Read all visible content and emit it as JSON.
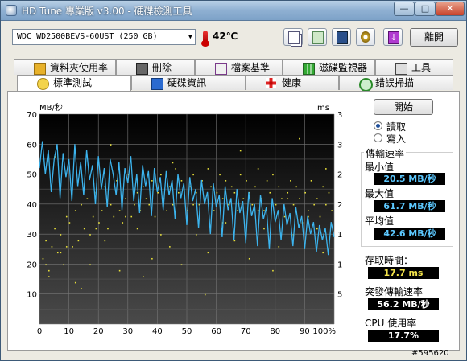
{
  "window": {
    "title": "HD Tune 專業版 v3.00 - 硬碟檢測工具"
  },
  "toolbar": {
    "drive": "WDC WD2500BEVS-60UST (250 GB)",
    "temperature": "42℃",
    "exit_label": "離開"
  },
  "tabs_top": [
    "資料夾使用率",
    "刪除",
    "檔案基準",
    "磁碟監視器",
    "工具"
  ],
  "tabs_bottom": [
    "標準測試",
    "硬碟資訊",
    "健康",
    "錯誤掃描"
  ],
  "controls": {
    "start_label": "開始",
    "read_label": "讀取",
    "write_label": "寫入",
    "mode": "read"
  },
  "stats": {
    "transfer_title": "傳輸速率",
    "min_label": "最小值",
    "min_value": "20.5 MB/秒",
    "max_label": "最大值",
    "max_value": "61.7 MB/秒",
    "avg_label": "平均值",
    "avg_value": "42.6 MB/秒",
    "access_label": "存取時間：",
    "access_value": "17.7 ms",
    "burst_label": "突發傳輸速率",
    "burst_value": "56.2 MB/秒",
    "cpu_label": "CPU 使用率",
    "cpu_value": "17.7%"
  },
  "chart_data": {
    "type": "line",
    "ylabel_left": "MB/秒",
    "ylabel_right": "ms",
    "y_left_ticks": [
      10,
      20,
      30,
      40,
      50,
      60,
      70
    ],
    "y_right_ticks": [
      5,
      10,
      15,
      20,
      25,
      30,
      35
    ],
    "x_ticks": [
      "0",
      "10",
      "20",
      "30",
      "40",
      "50",
      "60",
      "70",
      "80",
      "90",
      "100%"
    ],
    "xlim": [
      0,
      100
    ],
    "ylim_left": [
      0,
      70
    ],
    "ylim_right": [
      0,
      35
    ],
    "series": [
      {
        "x": [
          0,
          1,
          2,
          3,
          4,
          5,
          6,
          7,
          8,
          9,
          10,
          11,
          12,
          13,
          14,
          15,
          16,
          17,
          18,
          19,
          20,
          21,
          22,
          23,
          24,
          25,
          26,
          27,
          28,
          29,
          30,
          31,
          32,
          33,
          34,
          35,
          36,
          37,
          38,
          39,
          40,
          41,
          42,
          43,
          44,
          45,
          46,
          47,
          48,
          49,
          50,
          51,
          52,
          53,
          54,
          55,
          56,
          57,
          58,
          59,
          60,
          61,
          62,
          63,
          64,
          65,
          66,
          67,
          68,
          69,
          70,
          71,
          72,
          73,
          74,
          75,
          76,
          77,
          78,
          79,
          80,
          81,
          82,
          83,
          84,
          85,
          86,
          87,
          88,
          89,
          90,
          91,
          92,
          93,
          94,
          95,
          96,
          97,
          98,
          99,
          100
        ],
        "values": [
          52,
          61,
          50,
          58,
          44,
          55,
          60,
          42,
          57,
          49,
          55,
          41,
          60,
          46,
          54,
          43,
          58,
          48,
          53,
          40,
          56,
          45,
          52,
          39,
          55,
          50,
          43,
          54,
          38,
          52,
          47,
          56,
          41,
          50,
          37,
          53,
          46,
          51,
          36,
          52,
          44,
          49,
          38,
          51,
          43,
          48,
          35,
          50,
          42,
          47,
          33,
          49,
          41,
          45,
          32,
          48,
          40,
          44,
          30,
          47,
          39,
          43,
          29,
          46,
          38,
          42,
          28,
          45,
          37,
          41,
          27,
          44,
          36,
          40,
          26,
          43,
          35,
          39,
          25,
          42,
          34,
          38,
          28,
          40,
          33,
          37,
          26,
          39,
          32,
          36,
          25,
          36,
          30,
          34,
          24,
          33,
          28,
          32,
          23,
          34,
          29
        ]
      }
    ],
    "scatter_series": {
      "x": [
        1,
        2,
        3,
        4,
        5,
        6,
        7,
        8,
        9,
        10,
        11,
        12,
        13,
        14,
        15,
        16,
        17,
        18,
        19,
        20,
        21,
        22,
        23,
        24,
        25,
        26,
        27,
        28,
        29,
        30,
        31,
        32,
        33,
        34,
        35,
        36,
        37,
        38,
        39,
        40,
        41,
        42,
        43,
        44,
        45,
        46,
        47,
        48,
        49,
        50,
        51,
        52,
        53,
        54,
        55,
        56,
        57,
        58,
        59,
        60,
        61,
        62,
        63,
        64,
        65,
        66,
        67,
        68,
        69,
        70,
        71,
        72,
        73,
        74,
        75,
        76,
        77,
        78,
        79,
        80,
        81,
        82,
        83,
        84,
        85,
        86,
        87,
        88,
        89,
        90,
        91,
        92,
        93,
        94,
        95,
        96,
        97,
        98,
        99,
        3,
        7,
        12,
        17,
        22,
        27,
        33,
        38,
        44,
        48,
        53,
        57,
        62,
        66,
        71,
        76,
        81,
        86,
        91,
        96,
        5,
        14,
        24,
        35,
        45,
        56,
        68,
        79,
        88,
        97,
        2,
        9,
        19,
        29,
        41,
        52,
        63,
        74,
        84,
        94
      ],
      "values": [
        11,
        14,
        9,
        13,
        16,
        12,
        15,
        10,
        18,
        17,
        13,
        19,
        14,
        20,
        16,
        21,
        15,
        18,
        22,
        17,
        19,
        23,
        16,
        20,
        18,
        24,
        19,
        17,
        21,
        25,
        18,
        20,
        22,
        19,
        23,
        21,
        20,
        24,
        18,
        22,
        25,
        21,
        19,
        23,
        20,
        26,
        22,
        24,
        21,
        19,
        23,
        25,
        22,
        20,
        24,
        21,
        26,
        23,
        19,
        22,
        25,
        21,
        24,
        20,
        23,
        22,
        19,
        25,
        21,
        24,
        22,
        20,
        23,
        26,
        21,
        19,
        24,
        22,
        25,
        20,
        23,
        21,
        18,
        22,
        24,
        20,
        23,
        21,
        17,
        22,
        19,
        24,
        20,
        21,
        18,
        23,
        20,
        22,
        19,
        8,
        12,
        7,
        10,
        14,
        9,
        16,
        11,
        13,
        10,
        15,
        12,
        17,
        14,
        11,
        16,
        13,
        15,
        18,
        12,
        28,
        6,
        30,
        8,
        27,
        5,
        29,
        9,
        31,
        26,
        10,
        13,
        16,
        18,
        15,
        20,
        17,
        19,
        21,
        16
      ]
    }
  }
}
